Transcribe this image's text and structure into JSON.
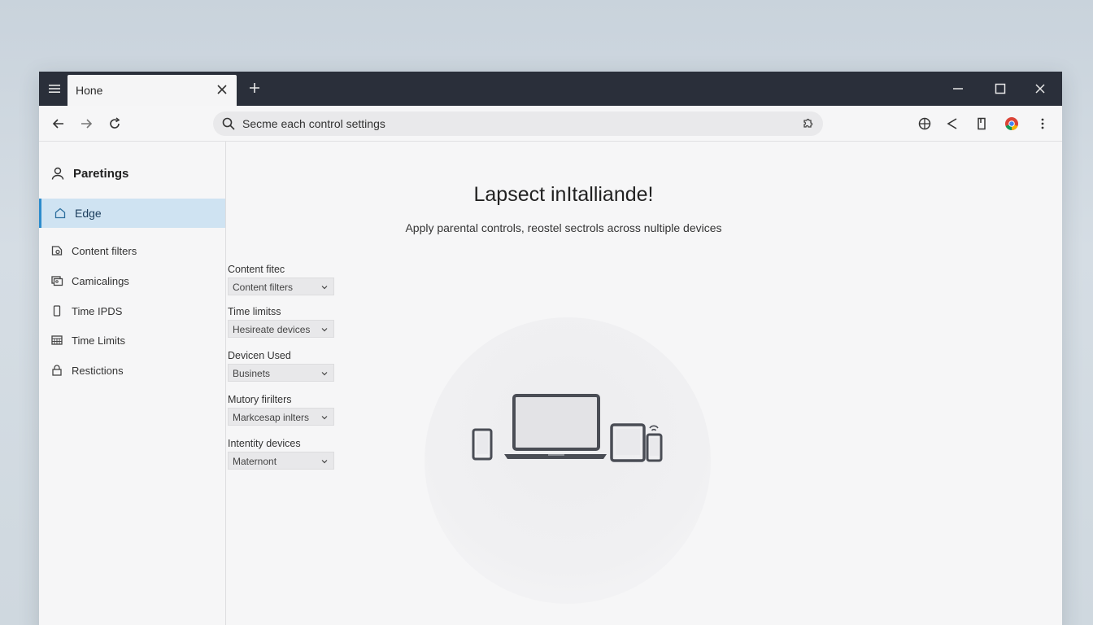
{
  "tab": {
    "title": "Hone"
  },
  "address_bar": {
    "text": "Secme each control settings"
  },
  "sidebar": {
    "profile_label": "Paretings",
    "items": [
      {
        "label": "Edge",
        "icon": "home-icon",
        "active": true
      },
      {
        "label": "Content filters",
        "icon": "filter-icon"
      },
      {
        "label": "Camicalings",
        "icon": "gallery-icon"
      },
      {
        "label": "Time IPDS",
        "icon": "phone-icon"
      },
      {
        "label": "Time Limits",
        "icon": "calendar-icon"
      },
      {
        "label": "Restictions",
        "icon": "lock-icon"
      }
    ]
  },
  "form": {
    "fields": [
      {
        "label": "Content fitec",
        "value": "Content filters"
      },
      {
        "label": "Time limitss",
        "value": "Hesireate devices"
      },
      {
        "label": "Devicen Used",
        "value": "Businets"
      },
      {
        "label": "Mutory firilters",
        "value": "Markcesap inlters"
      },
      {
        "label": "Intentity devices",
        "value": "Maternont"
      }
    ]
  },
  "main": {
    "heading": "Lapsect inItalliande!",
    "subtext": "Apply parental controls, reostel sectrols across nultiple devices"
  },
  "colors": {
    "titlebar": "#2a2f3a",
    "accent": "#2d8ccc",
    "active_bg": "#cfe3f2"
  }
}
